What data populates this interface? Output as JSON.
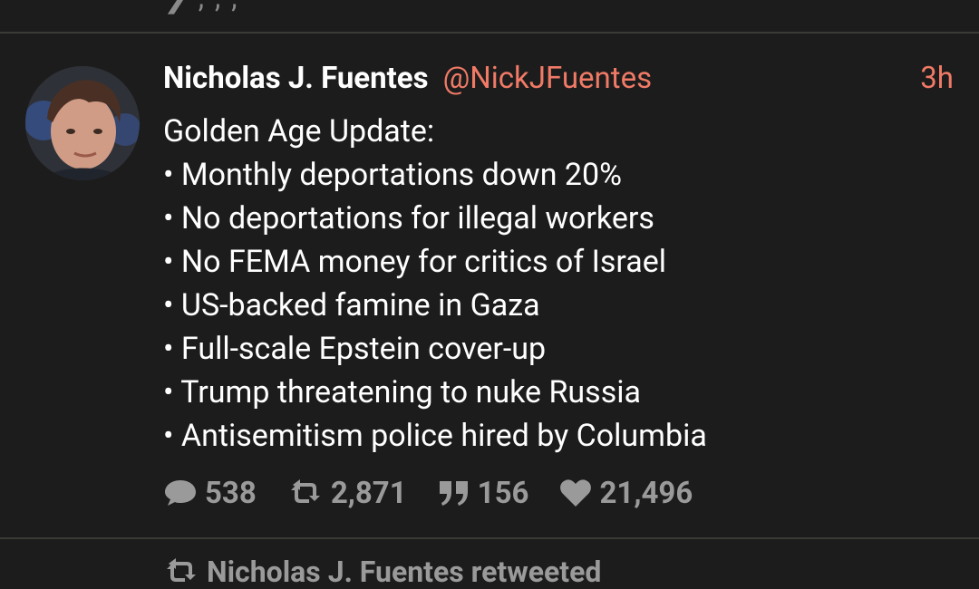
{
  "tweet": {
    "display_name": "Nicholas J. Fuentes",
    "handle": "@NickJFuentes",
    "time": "3h",
    "lines": [
      "Golden Age Update:",
      "• Monthly deportations down 20%",
      "• No deportations for illegal workers",
      "• No FEMA money for critics of Israel",
      "• US-backed famine in Gaza",
      "• Full-scale Epstein cover-up",
      "• Trump threatening to nuke Russia",
      "• Antisemitism police hired by Columbia"
    ],
    "actions": {
      "replies": "538",
      "retweets": "2,871",
      "quotes": "156",
      "likes": "21,496"
    }
  },
  "next_item": {
    "retweet_label": "Nicholas J. Fuentes retweeted"
  },
  "colors": {
    "background": "#1c1c1c",
    "accent": "#f07a66",
    "muted": "#9a9a9a",
    "divider": "#3a3a36"
  },
  "icons": {
    "reply": "speech-bubble-icon",
    "retweet": "retweet-icon",
    "quote": "quote-icon",
    "like": "heart-icon"
  }
}
